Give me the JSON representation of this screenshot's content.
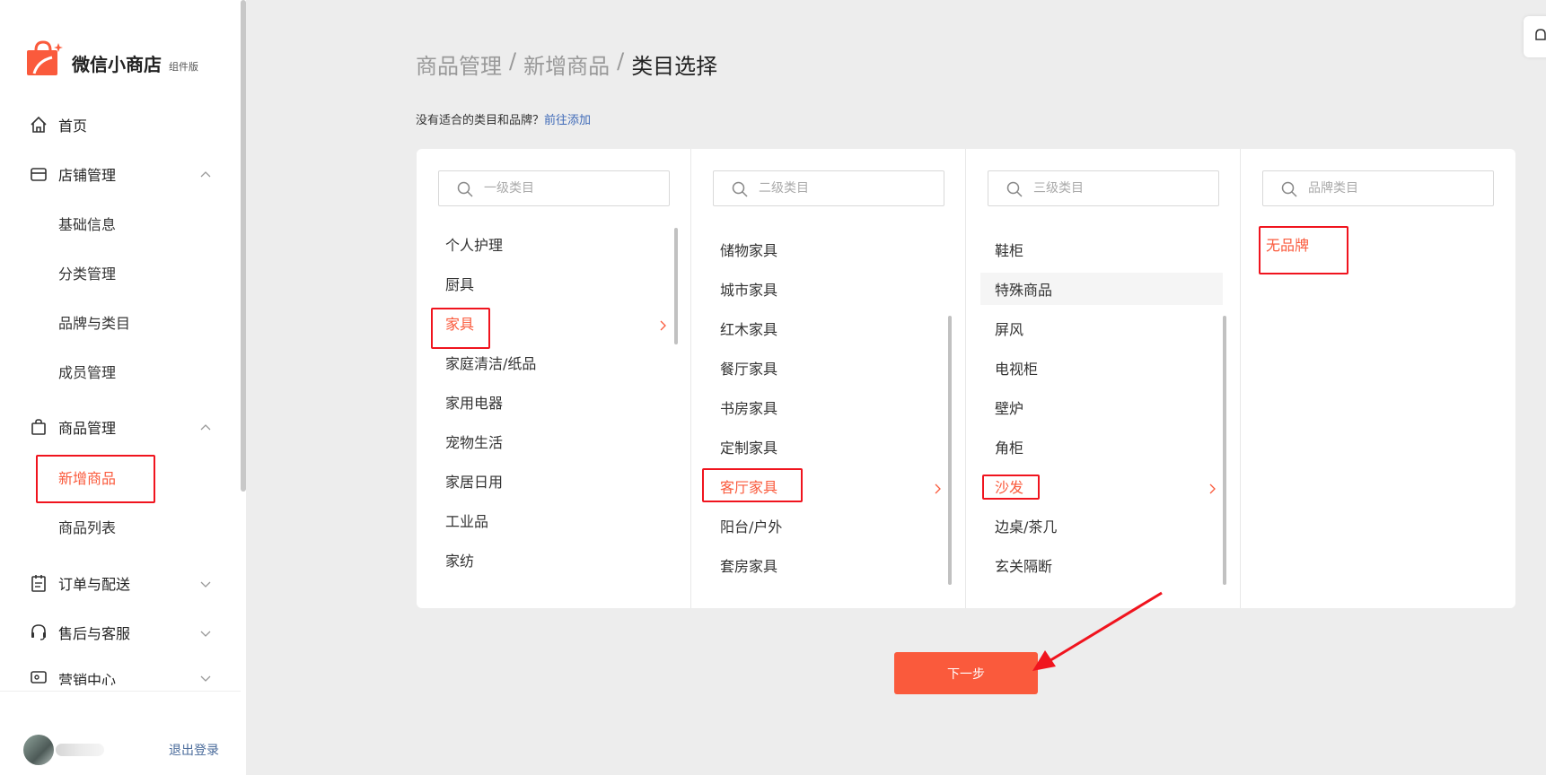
{
  "app": {
    "name": "微信小商店",
    "tag": "组件版"
  },
  "sidebar": {
    "home": "首页",
    "store_mgmt": "店铺管理",
    "store_sub": [
      "基础信息",
      "分类管理",
      "品牌与类目",
      "成员管理"
    ],
    "goods_mgmt": "商品管理",
    "goods_sub": [
      "新增商品",
      "商品列表"
    ],
    "orders": "订单与配送",
    "aftersale": "售后与客服",
    "marketing": "营销中心",
    "logout": "退出登录"
  },
  "breadcrumb": {
    "a": "商品管理",
    "sep": "/",
    "b": "新增商品",
    "c": "类目选择"
  },
  "hint": {
    "text": "没有适合的类目和品牌？",
    "link": "前往添加"
  },
  "columns": [
    {
      "placeholder": "一级类目",
      "items": [
        "个人护理",
        "厨具",
        "家具",
        "家庭清洁/纸品",
        "家用电器",
        "宠物生活",
        "家居日用",
        "工业品",
        "家纺"
      ],
      "selected": "家具"
    },
    {
      "placeholder": "二级类目",
      "items": [
        "储物家具",
        "城市家具",
        "红木家具",
        "餐厅家具",
        "书房家具",
        "定制家具",
        "客厅家具",
        "阳台/户外",
        "套房家具"
      ],
      "selected": "客厅家具"
    },
    {
      "placeholder": "三级类目",
      "items": [
        "鞋柜",
        "特殊商品",
        "屏风",
        "电视柜",
        "壁炉",
        "角柜",
        "沙发",
        "边桌/茶几",
        "玄关隔断"
      ],
      "selected": "沙发"
    },
    {
      "placeholder": "品牌类目",
      "items": [
        "无品牌"
      ],
      "selected": "无品牌"
    }
  ],
  "next_button": "下一步",
  "colors": {
    "accent": "#fa5a3c",
    "annotation": "#f0141e",
    "link": "#3f6ab8"
  }
}
